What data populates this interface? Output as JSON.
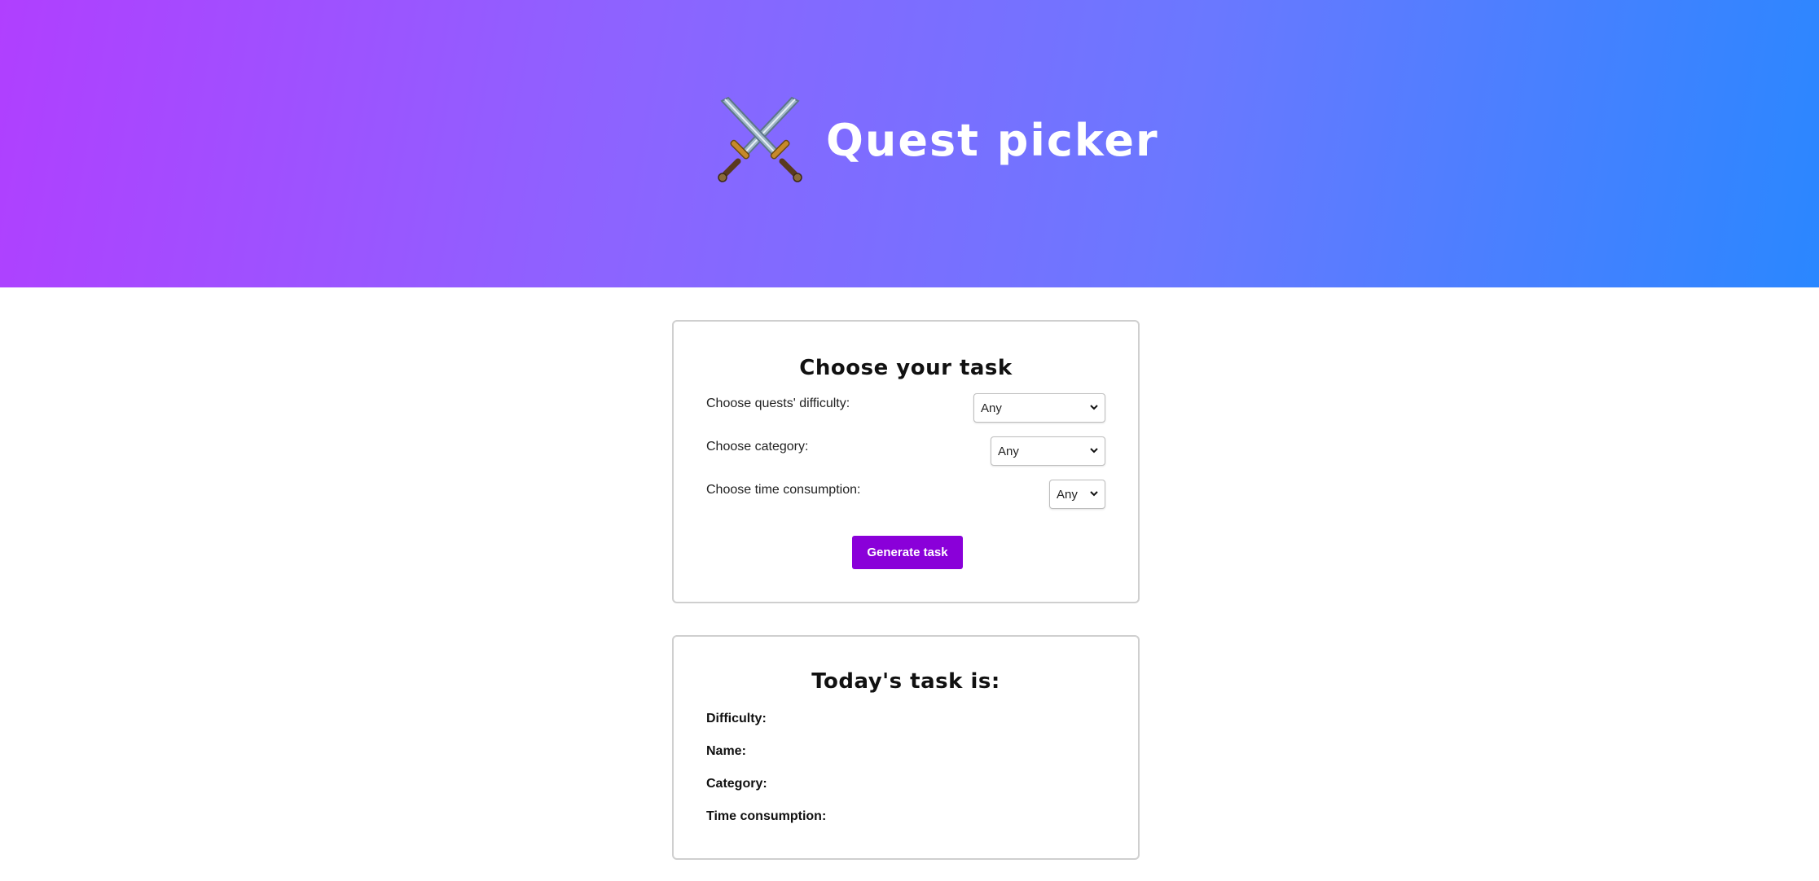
{
  "header": {
    "title": "Quest picker",
    "logo_icon": "crossed-swords-icon",
    "gradient_colors": [
      "#b03fff",
      "#8c64ff",
      "#6a78ff",
      "#2a87ff"
    ]
  },
  "chooser": {
    "title": "Choose your task",
    "difficulty": {
      "label": "Choose quests' difficulty:",
      "value": "Any"
    },
    "category": {
      "label": "Choose category:",
      "value": "Any"
    },
    "time": {
      "label": "Choose time consumption:",
      "value": "Any"
    },
    "generate_label": "Generate task",
    "button_color": "#8a00d9"
  },
  "result": {
    "title": "Today's task is:",
    "difficulty_label": "Difficulty:",
    "name_label": "Name:",
    "category_label": "Category:",
    "time_label": "Time consumption:"
  }
}
